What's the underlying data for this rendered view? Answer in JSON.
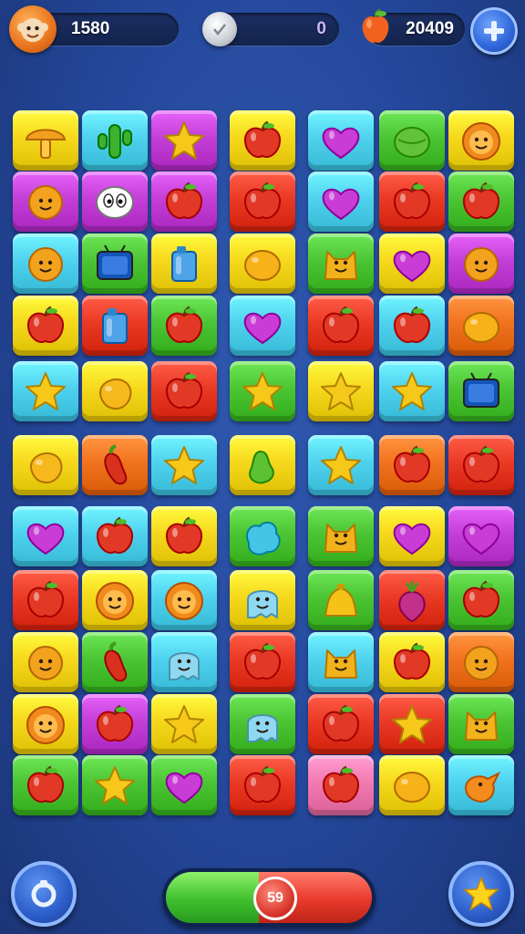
{
  "hud": {
    "score": "1580",
    "coins": "0",
    "fruit": "20409"
  },
  "progress": {
    "value": 0.45,
    "knob_label": "59",
    "fill_color": "#3fbf2d",
    "empty_color": "#e8392c"
  },
  "colors": {
    "Y": "#f6d81c",
    "C": "#4fd2ee",
    "P": "#c43fd8",
    "G": "#4cc534",
    "R": "#ea3a25",
    "O": "#f2731f",
    "K": "#f27ab0"
  },
  "board": [
    [
      [
        "Y",
        "mushroom-icon"
      ],
      [
        "C",
        "cactus-icon"
      ],
      [
        "P",
        "star-icon"
      ],
      [
        "Y",
        "apple-icon"
      ],
      [
        "C",
        "heart-icon"
      ],
      [
        "G",
        "melon-icon"
      ],
      [
        "Y",
        "lion-face-icon"
      ]
    ],
    [
      [
        "P",
        "smiley-icon"
      ],
      [
        "P",
        "eyes-face-icon"
      ],
      [
        "P",
        "apple-icon"
      ],
      [
        "R",
        "apple-icon"
      ],
      [
        "C",
        "heart-icon"
      ],
      [
        "R",
        "apple-icon"
      ],
      [
        "G",
        "apple-icon"
      ]
    ],
    [
      [
        "C",
        "smiley-icon"
      ],
      [
        "G",
        "tv-icon"
      ],
      [
        "Y",
        "cup-icon"
      ],
      [
        "Y",
        "lemon-icon"
      ],
      [
        "G",
        "cat-face-icon"
      ],
      [
        "Y",
        "heart-icon"
      ],
      [
        "P",
        "smiley-icon"
      ]
    ],
    [
      [
        "Y",
        "apple-icon"
      ],
      [
        "R",
        "cup-icon"
      ],
      [
        "G",
        "apple-icon"
      ],
      [
        "C",
        "heart-icon"
      ],
      [
        "R",
        "apple-icon"
      ],
      [
        "C",
        "apple-icon"
      ],
      [
        "O",
        "lemon-icon"
      ]
    ],
    [
      [
        "C",
        "star-icon"
      ],
      [
        "Y",
        "mango-icon"
      ],
      [
        "R",
        "apple-icon"
      ],
      [
        "G",
        "star-icon"
      ],
      [
        "Y",
        "star-icon"
      ],
      [
        "C",
        "star-icon"
      ],
      [
        "G",
        "tv-icon"
      ]
    ],
    [
      [
        "Y",
        "mango-icon"
      ],
      [
        "O",
        "pepper-icon"
      ],
      [
        "C",
        "star-icon"
      ],
      [
        "Y",
        "pear-icon"
      ],
      [
        "C",
        "star-icon"
      ],
      [
        "O",
        "apple-icon"
      ],
      [
        "R",
        "apple-icon"
      ]
    ],
    [
      [
        "C",
        "heart-icon"
      ],
      [
        "C",
        "apple-icon"
      ],
      [
        "Y",
        "apple-icon"
      ],
      [
        "G",
        "blob-icon"
      ],
      [
        "G",
        "cat-face-icon"
      ],
      [
        "Y",
        "heart-icon"
      ],
      [
        "P",
        "heart-icon"
      ]
    ],
    [
      [
        "R",
        "apple-icon"
      ],
      [
        "Y",
        "lion-face-icon"
      ],
      [
        "C",
        "lion-face-icon"
      ],
      [
        "Y",
        "ghost-face-icon"
      ],
      [
        "G",
        "bell-icon"
      ],
      [
        "R",
        "radish-icon"
      ],
      [
        "G",
        "apple-icon"
      ]
    ],
    [
      [
        "Y",
        "smiley-icon"
      ],
      [
        "G",
        "pepper-icon"
      ],
      [
        "C",
        "ghost-face-icon"
      ],
      [
        "R",
        "apple-icon"
      ],
      [
        "C",
        "cat-face-icon"
      ],
      [
        "Y",
        "apple-icon"
      ],
      [
        "O",
        "smiley-icon"
      ]
    ],
    [
      [
        "Y",
        "lion-face-icon"
      ],
      [
        "P",
        "apple-icon"
      ],
      [
        "Y",
        "star-icon"
      ],
      [
        "G",
        "ghost-face-icon"
      ],
      [
        "R",
        "apple-icon"
      ],
      [
        "R",
        "star-icon"
      ],
      [
        "G",
        "cat-face-icon"
      ]
    ],
    [
      [
        "G",
        "apple-icon"
      ],
      [
        "G",
        "star-icon"
      ],
      [
        "G",
        "heart-icon"
      ],
      [
        "R",
        "apple-icon"
      ],
      [
        "K",
        "apple-icon"
      ],
      [
        "Y",
        "lemon-icon"
      ],
      [
        "C",
        "bird-icon"
      ]
    ]
  ],
  "icon_colors": {
    "mushroom-icon": "#f0a020",
    "cactus-icon": "#3cb22e",
    "star-icon": "#f6c81a",
    "apple-icon": "#e23826",
    "heart-icon": "#c93dd6",
    "melon-icon": "#63c338",
    "lion-face-icon": "#f08a1c",
    "smiley-icon": "#f2a21d",
    "eyes-face-icon": "#ffffff",
    "tv-icon": "#3a7de0",
    "cup-icon": "#4fa3e8",
    "lemon-icon": "#f7b21a",
    "cat-face-icon": "#f2b21c",
    "mango-icon": "#f6b81c",
    "pepper-icon": "#d8321f",
    "pear-icon": "#5cc234",
    "blob-icon": "#45c5e6",
    "ghost-face-icon": "#8fd8f2",
    "bell-icon": "#f6c21a",
    "radish-icon": "#c2308a",
    "bird-icon": "#f28c1c"
  },
  "bottom": {
    "left_button_icon": "refresh-icon",
    "right_button_icon": "star-icon"
  }
}
